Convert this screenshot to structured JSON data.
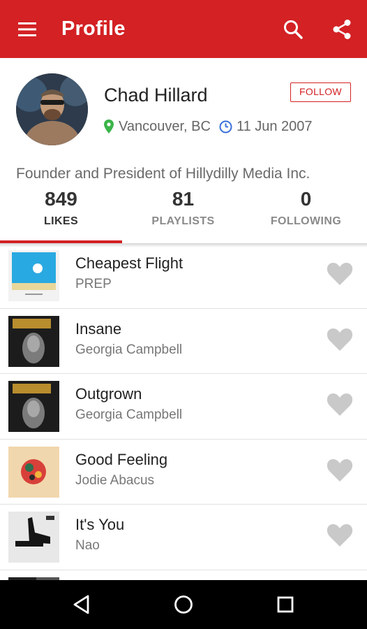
{
  "app_bar": {
    "title": "Profile",
    "background": "#d32124",
    "icons": [
      "menu-icon",
      "search-icon",
      "share-icon"
    ]
  },
  "profile": {
    "name": "Chad Hillard",
    "follow_label": "FOLLOW",
    "location": "Vancouver, BC",
    "joined": "11 Jun 2007",
    "bio": "Founder and President of Hillydilly Media Inc."
  },
  "tabs": [
    {
      "count": "849",
      "label": "LIKES",
      "active": true
    },
    {
      "count": "81",
      "label": "PLAYLISTS",
      "active": false
    },
    {
      "count": "0",
      "label": "FOLLOWING",
      "active": false
    }
  ],
  "tracks": [
    {
      "title": "Cheapest Flight",
      "artist": "PREP"
    },
    {
      "title": "Insane",
      "artist": "Georgia Campbell"
    },
    {
      "title": "Outgrown",
      "artist": "Georgia Campbell"
    },
    {
      "title": "Good Feeling",
      "artist": "Jodie Abacus"
    },
    {
      "title": "It's You",
      "artist": "Nao"
    }
  ],
  "colors": {
    "accent": "#d32124",
    "pin": "#3bb54a",
    "clock": "#3a6fd8",
    "heart": "#c9c9c9"
  },
  "nav": [
    "back-icon",
    "home-icon",
    "recents-icon"
  ]
}
